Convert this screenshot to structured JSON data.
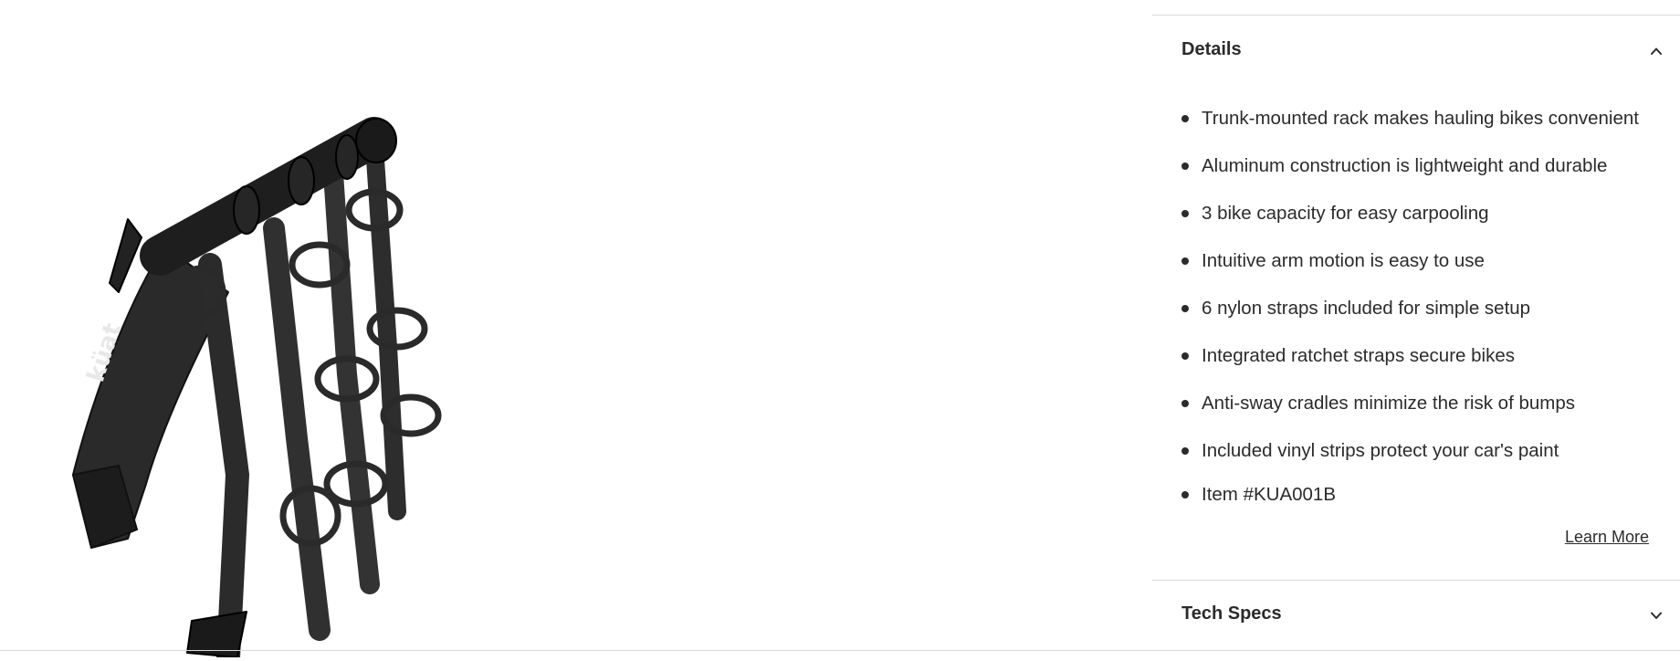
{
  "product": {
    "image_alt": "Kuat trunk-mounted 3-bike rack",
    "brand_mark": "küat"
  },
  "details": {
    "title": "Details",
    "expanded": true,
    "chevron": "chevron-up-icon",
    "features": [
      "Trunk-mounted rack makes hauling bikes convenient",
      "Aluminum construction is lightweight and durable",
      "3 bike capacity for easy carpooling",
      "Intuitive arm motion is easy to use",
      "6 nylon straps included for simple setup",
      "Integrated ratchet straps secure bikes",
      "Anti-sway cradles minimize the risk of bumps",
      "Included vinyl strips protect your car's paint",
      "Item #KUA001B"
    ],
    "learn_more": "Learn More"
  },
  "tech_specs": {
    "title": "Tech Specs",
    "expanded": false,
    "chevron": "chevron-down-icon"
  },
  "colors": {
    "text": "#2b2b2b",
    "rule": "#d9d9d9",
    "product": "#222222"
  }
}
